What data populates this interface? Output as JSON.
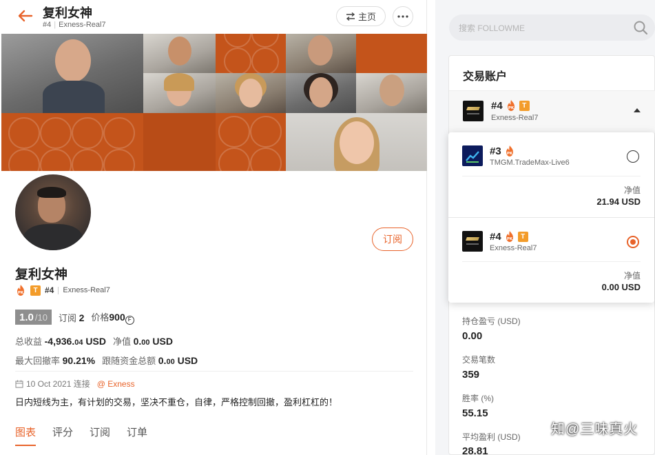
{
  "header": {
    "title": "复利女神",
    "rank": "#4",
    "server": "Exness-Real7",
    "home_label": "主页"
  },
  "profile": {
    "name": "复利女神",
    "pk_label": "PK",
    "t_label": "T",
    "rank": "#4",
    "server": "Exness-Real7",
    "subscribe_label": "订阅",
    "score": "1.0",
    "score_max": "/10",
    "subscribers_label": "订阅",
    "subscribers": "2",
    "price_label": "价格",
    "price": "900",
    "coin_symbol": "F",
    "total_profit_label": "总收益",
    "total_profit": "-4,936.",
    "total_profit_dec": "04",
    "total_profit_unit": "USD",
    "net_value_label": "净值",
    "net_value": "0.",
    "net_value_dec": "00",
    "net_value_unit": "USD",
    "max_drawdown_label": "最大回撤率",
    "max_drawdown": "90.21%",
    "follow_total_label": "跟随资金总额",
    "follow_total": "0.",
    "follow_total_dec": "00",
    "follow_total_unit": "USD",
    "date": "10 Oct 2021 连接",
    "broker": "@ Exness",
    "description": "日内短线为主，有计划的交易，坚决不重仓，自律，严格控制回撤，盈利杠杠的！"
  },
  "tabs": [
    {
      "label": "图表",
      "active": true
    },
    {
      "label": "评分",
      "active": false
    },
    {
      "label": "订阅",
      "active": false
    },
    {
      "label": "订单",
      "active": false
    }
  ],
  "search": {
    "placeholder": "搜索 FOLLOWME"
  },
  "account_panel": {
    "title": "交易账户",
    "selected": {
      "rank": "#4",
      "server": "Exness-Real7",
      "pk_label": "PK",
      "t_label": "T"
    },
    "options": [
      {
        "rank": "#3",
        "pk_label": "PK",
        "server": "TMGM.TradeMax-Live6",
        "net_label": "净值",
        "net_value": "21.94 USD",
        "selected": false
      },
      {
        "rank": "#4",
        "pk_label": "PK",
        "t_label": "T",
        "server": "Exness-Real7",
        "net_label": "净值",
        "net_value": "0.00 USD",
        "selected": true
      }
    ],
    "stats": [
      {
        "label": "持仓盈亏 (USD)",
        "value": "0.00"
      },
      {
        "label": "交易笔数",
        "value": "359"
      },
      {
        "label": "胜率 (%)",
        "value": "55.15"
      },
      {
        "label": "平均盈利 (USD)",
        "value": "28.81"
      }
    ]
  },
  "watermark": "知@三味真火",
  "colors": {
    "accent": "#e8632a",
    "badge": "#f39c2a",
    "banner": "#c4541b"
  }
}
